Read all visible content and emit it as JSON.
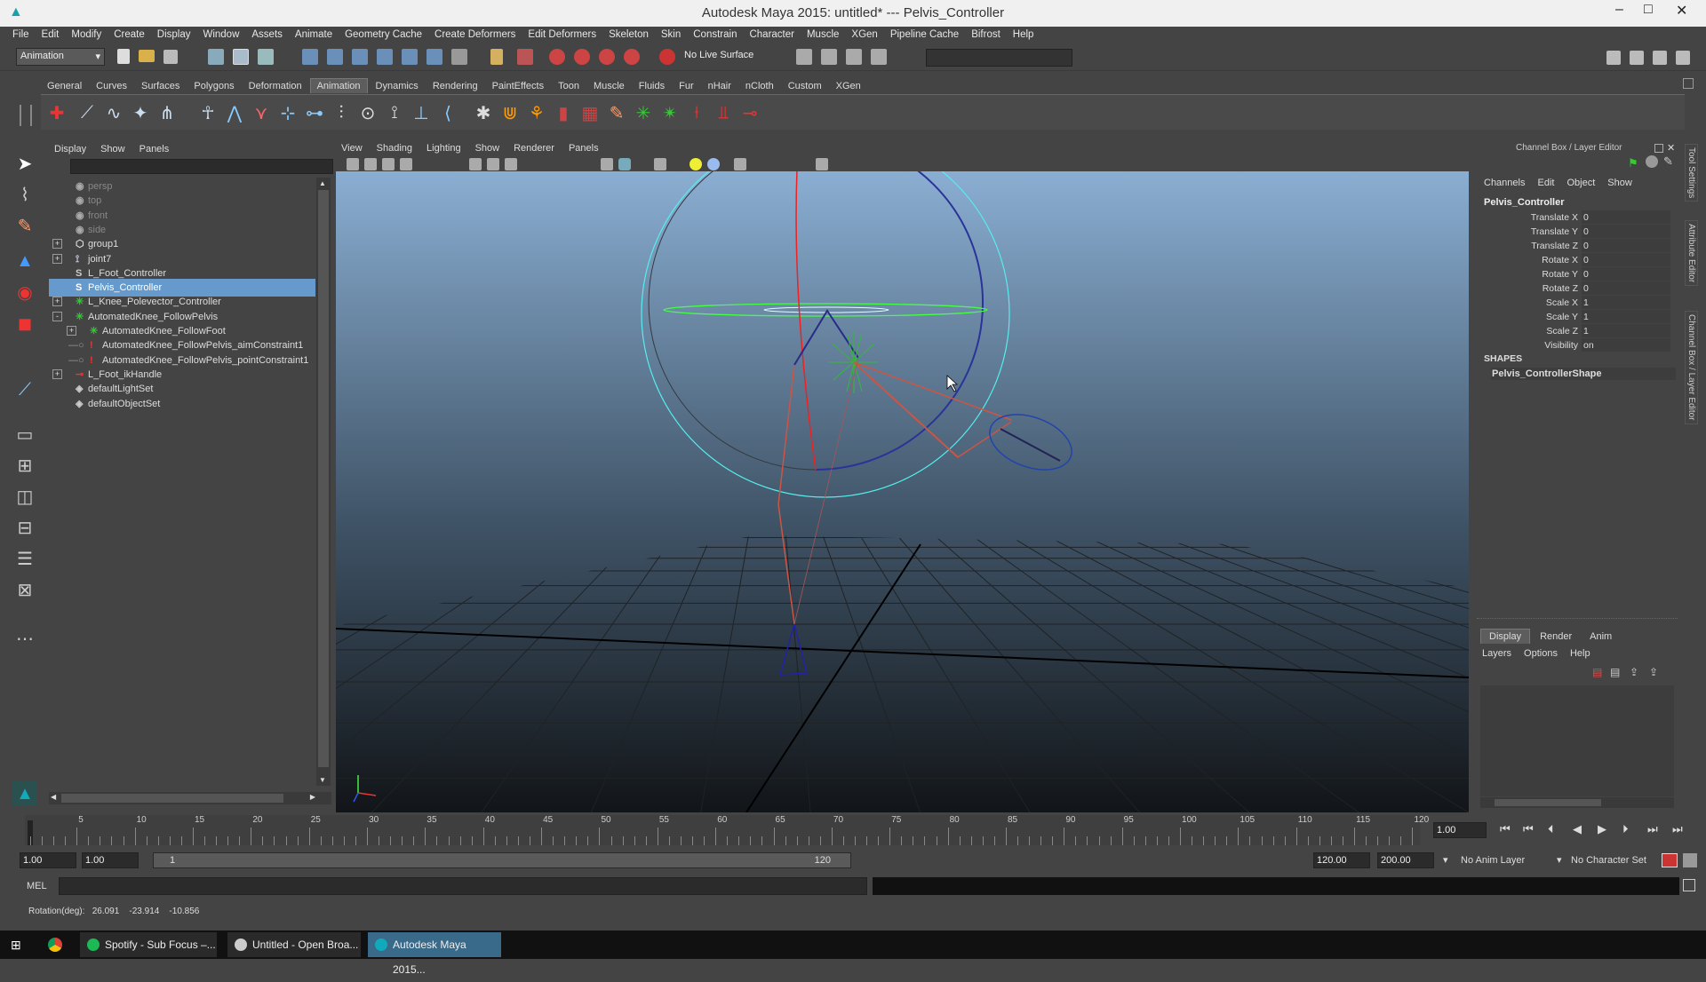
{
  "window": {
    "title": "Autodesk Maya 2015: untitled*   ---   Pelvis_Controller"
  },
  "menubar": [
    "File",
    "Edit",
    "Modify",
    "Create",
    "Display",
    "Window",
    "Assets",
    "Animate",
    "Geometry Cache",
    "Create Deformers",
    "Edit Deformers",
    "Skeleton",
    "Skin",
    "Constrain",
    "Character",
    "Muscle",
    "XGen",
    "Pipeline Cache",
    "Bifrost",
    "Help"
  ],
  "statusline": {
    "menuset": "Animation",
    "live_surface": "No Live Surface"
  },
  "shelf_tabs": [
    "General",
    "Curves",
    "Surfaces",
    "Polygons",
    "Deformation",
    "Animation",
    "Dynamics",
    "Rendering",
    "PaintEffects",
    "Toon",
    "Muscle",
    "Fluids",
    "Fur",
    "nHair",
    "nCloth",
    "Custom",
    "XGen"
  ],
  "shelf_active": "Animation",
  "outliner": {
    "menu": [
      "Display",
      "Show",
      "Panels"
    ],
    "items": [
      {
        "label": "persp",
        "depth": 0,
        "icon": "camera-icon",
        "dim": true,
        "expander": ""
      },
      {
        "label": "top",
        "depth": 0,
        "icon": "camera-icon",
        "dim": true,
        "expander": ""
      },
      {
        "label": "front",
        "depth": 0,
        "icon": "camera-icon",
        "dim": true,
        "expander": ""
      },
      {
        "label": "side",
        "depth": 0,
        "icon": "camera-icon",
        "dim": true,
        "expander": ""
      },
      {
        "label": "group1",
        "depth": 0,
        "icon": "group-icon",
        "dim": false,
        "expander": "+"
      },
      {
        "label": "joint7",
        "depth": 0,
        "icon": "joint-icon",
        "dim": false,
        "expander": "+"
      },
      {
        "label": "L_Foot_Controller",
        "depth": 0,
        "icon": "curve-icon",
        "dim": false,
        "expander": ""
      },
      {
        "label": "Pelvis_Controller",
        "depth": 0,
        "icon": "curve-icon",
        "dim": false,
        "expander": "",
        "selected": true
      },
      {
        "label": "L_Knee_Polevector_Controller",
        "depth": 0,
        "icon": "locator-icon",
        "dim": false,
        "expander": "+"
      },
      {
        "label": "AutomatedKnee_FollowPelvis",
        "depth": 0,
        "icon": "locator-icon",
        "dim": false,
        "expander": "-"
      },
      {
        "label": "AutomatedKnee_FollowFoot",
        "depth": 1,
        "icon": "locator-icon",
        "dim": false,
        "expander": "+"
      },
      {
        "label": "AutomatedKnee_FollowPelvis_aimConstraint1",
        "depth": 1,
        "icon": "constraint-icon",
        "dim": false,
        "expander": ""
      },
      {
        "label": "AutomatedKnee_FollowPelvis_pointConstraint1",
        "depth": 1,
        "icon": "constraint-icon",
        "dim": false,
        "expander": ""
      },
      {
        "label": "L_Foot_ikHandle",
        "depth": 0,
        "icon": "ikhandle-icon",
        "dim": false,
        "expander": "+"
      },
      {
        "label": "defaultLightSet",
        "depth": 0,
        "icon": "set-icon",
        "dim": false,
        "expander": ""
      },
      {
        "label": "defaultObjectSet",
        "depth": 0,
        "icon": "set-icon",
        "dim": false,
        "expander": ""
      }
    ]
  },
  "viewport": {
    "menu": [
      "View",
      "Shading",
      "Lighting",
      "Show",
      "Renderer",
      "Panels"
    ]
  },
  "channelbox": {
    "header": "Channel Box / Layer Editor",
    "menu": [
      "Channels",
      "Edit",
      "Object",
      "Show"
    ],
    "object": "Pelvis_Controller",
    "channels": [
      {
        "label": "Translate X",
        "value": "0"
      },
      {
        "label": "Translate Y",
        "value": "0"
      },
      {
        "label": "Translate Z",
        "value": "0"
      },
      {
        "label": "Rotate X",
        "value": "0"
      },
      {
        "label": "Rotate Y",
        "value": "0"
      },
      {
        "label": "Rotate Z",
        "value": "0"
      },
      {
        "label": "Scale X",
        "value": "1"
      },
      {
        "label": "Scale Y",
        "value": "1"
      },
      {
        "label": "Scale Z",
        "value": "1"
      },
      {
        "label": "Visibility",
        "value": "on"
      }
    ],
    "shapes_label": "SHAPES",
    "shape": "Pelvis_ControllerShape",
    "layer_tabs": [
      "Display",
      "Render",
      "Anim"
    ],
    "layer_menu": [
      "Layers",
      "Options",
      "Help"
    ]
  },
  "right_tabs": [
    "Tool Settings",
    "Attribute Editor",
    "Channel Box / Layer Editor"
  ],
  "timeslider": {
    "ticks": [
      "5",
      "10",
      "15",
      "20",
      "25",
      "30",
      "35",
      "40",
      "45",
      "50",
      "55",
      "60",
      "65",
      "70",
      "75",
      "80",
      "85",
      "90",
      "95",
      "100",
      "105",
      "110",
      "115",
      "120"
    ],
    "current_frame": "1.00"
  },
  "range": {
    "start": "1.00",
    "playback_start": "1.00",
    "range_start_label": "1",
    "range_end_label": "120",
    "playback_end": "120.00",
    "end": "200.00",
    "anim_layer": "No Anim Layer",
    "character_set": "No Character Set"
  },
  "cmdline": {
    "label": "MEL"
  },
  "helpline": {
    "text": "Rotation(deg):   26.091    -23.914    -10.856"
  },
  "taskbar": [
    {
      "label": "Spotify - Sub Focus –..."
    },
    {
      "label": "Untitled - Open Broa..."
    },
    {
      "label": "Autodesk Maya 2015..."
    }
  ]
}
